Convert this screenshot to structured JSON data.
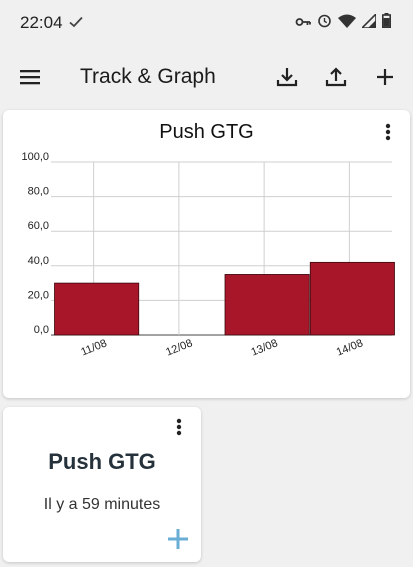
{
  "status_bar": {
    "time": "22:04"
  },
  "app_bar": {
    "title": "Track & Graph"
  },
  "graph_card": {
    "title": "Push GTG"
  },
  "tracker_card": {
    "name": "Push GTG",
    "last_logged": "Il y a 59 minutes"
  },
  "colors": {
    "bar": "#a81629",
    "add_accent": "#6aaed6"
  },
  "icons": [
    "menu-icon",
    "download-icon",
    "upload-icon",
    "add-icon",
    "more-vert-icon",
    "check-icon",
    "key-icon",
    "alarm-icon",
    "wifi-icon",
    "signal-icon",
    "battery-icon"
  ],
  "chart_data": {
    "type": "bar",
    "categories": [
      "11/08",
      "12/08",
      "13/08",
      "14/08"
    ],
    "values": [
      30,
      0,
      35,
      42
    ],
    "y_ticks": [
      "0,0",
      "20,0",
      "40,0",
      "60,0",
      "80,0",
      "100,0"
    ],
    "ylim": [
      0,
      100
    ],
    "grid": true
  }
}
